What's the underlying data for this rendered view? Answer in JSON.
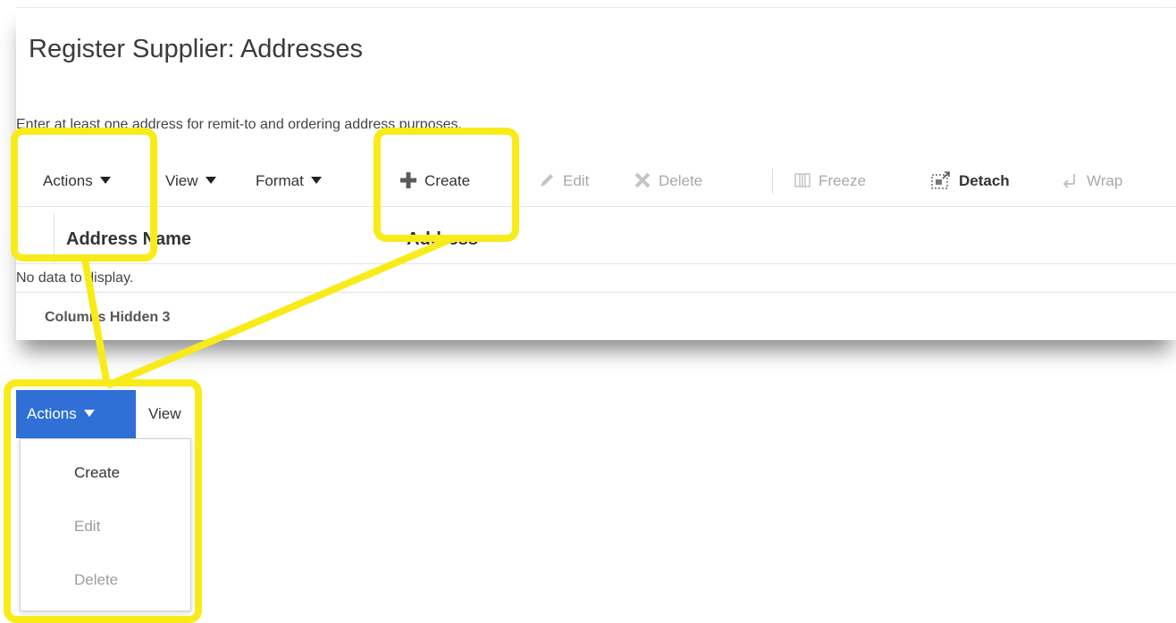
{
  "page": {
    "title": "Register Supplier: Addresses",
    "instruction": "Enter at least one address for remit-to and ordering address purposes."
  },
  "toolbar": {
    "actions_label": "Actions",
    "view_label": "View",
    "format_label": "Format",
    "create_label": "Create",
    "edit_label": "Edit",
    "delete_label": "Delete",
    "freeze_label": "Freeze",
    "detach_label": "Detach",
    "wrap_label": "Wrap"
  },
  "table": {
    "columns": [
      "Address Name",
      "Address"
    ],
    "empty_text": "No data to display.",
    "footer": "Columns Hidden 3"
  },
  "inset": {
    "button_label": "Actions",
    "view_label": "View",
    "menu_items": [
      {
        "label": "Create",
        "enabled": true
      },
      {
        "label": "Edit",
        "enabled": false
      },
      {
        "label": "Delete",
        "enabled": false
      }
    ]
  },
  "colors": {
    "highlight": "#f7ec1a",
    "actions_button_bg": "#2f6fd6",
    "disabled_text": "#a8a8a8"
  },
  "icons": {
    "create": "plus-icon",
    "edit": "pencil-icon",
    "delete": "x-icon",
    "freeze": "freeze-columns-icon",
    "detach": "detach-icon",
    "wrap": "wrap-icon",
    "dropdown": "caret-down-icon"
  }
}
